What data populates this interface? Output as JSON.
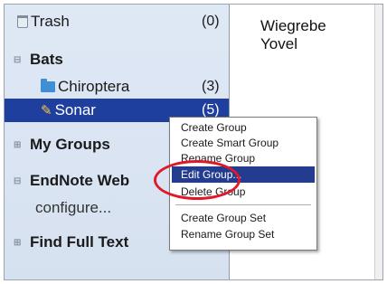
{
  "library": {
    "trash": {
      "label": "Trash",
      "count": "(0)"
    },
    "bats": {
      "label": "Bats",
      "expander": "⊟"
    },
    "chiroptera": {
      "label": "Chiroptera",
      "count": "(3)"
    },
    "sonar": {
      "label": "Sonar",
      "count": "(5)"
    },
    "my_groups": {
      "label": "My Groups",
      "expander": "⊞"
    },
    "endnote_web": {
      "label": "EndNote Web",
      "expander": "⊟"
    },
    "configure": {
      "label": "configure..."
    },
    "find_full_text": {
      "label": "Find Full Text",
      "expander": "⊞"
    }
  },
  "references": {
    "authors": [
      "Wiegrebe",
      "Yovel"
    ]
  },
  "context_menu": {
    "items": [
      "Create Group",
      "Create Smart Group",
      "Rename Group",
      "Edit Group...",
      "Delete Group",
      "Create Group Set",
      "Rename Group Set"
    ],
    "highlighted_item": "Edit Group...",
    "highlight_color": "#243c8f"
  },
  "colors": {
    "selection": "#1f3f9e",
    "annotation_circle": "#e0182b",
    "folder_icon": "#3f8fd6"
  }
}
